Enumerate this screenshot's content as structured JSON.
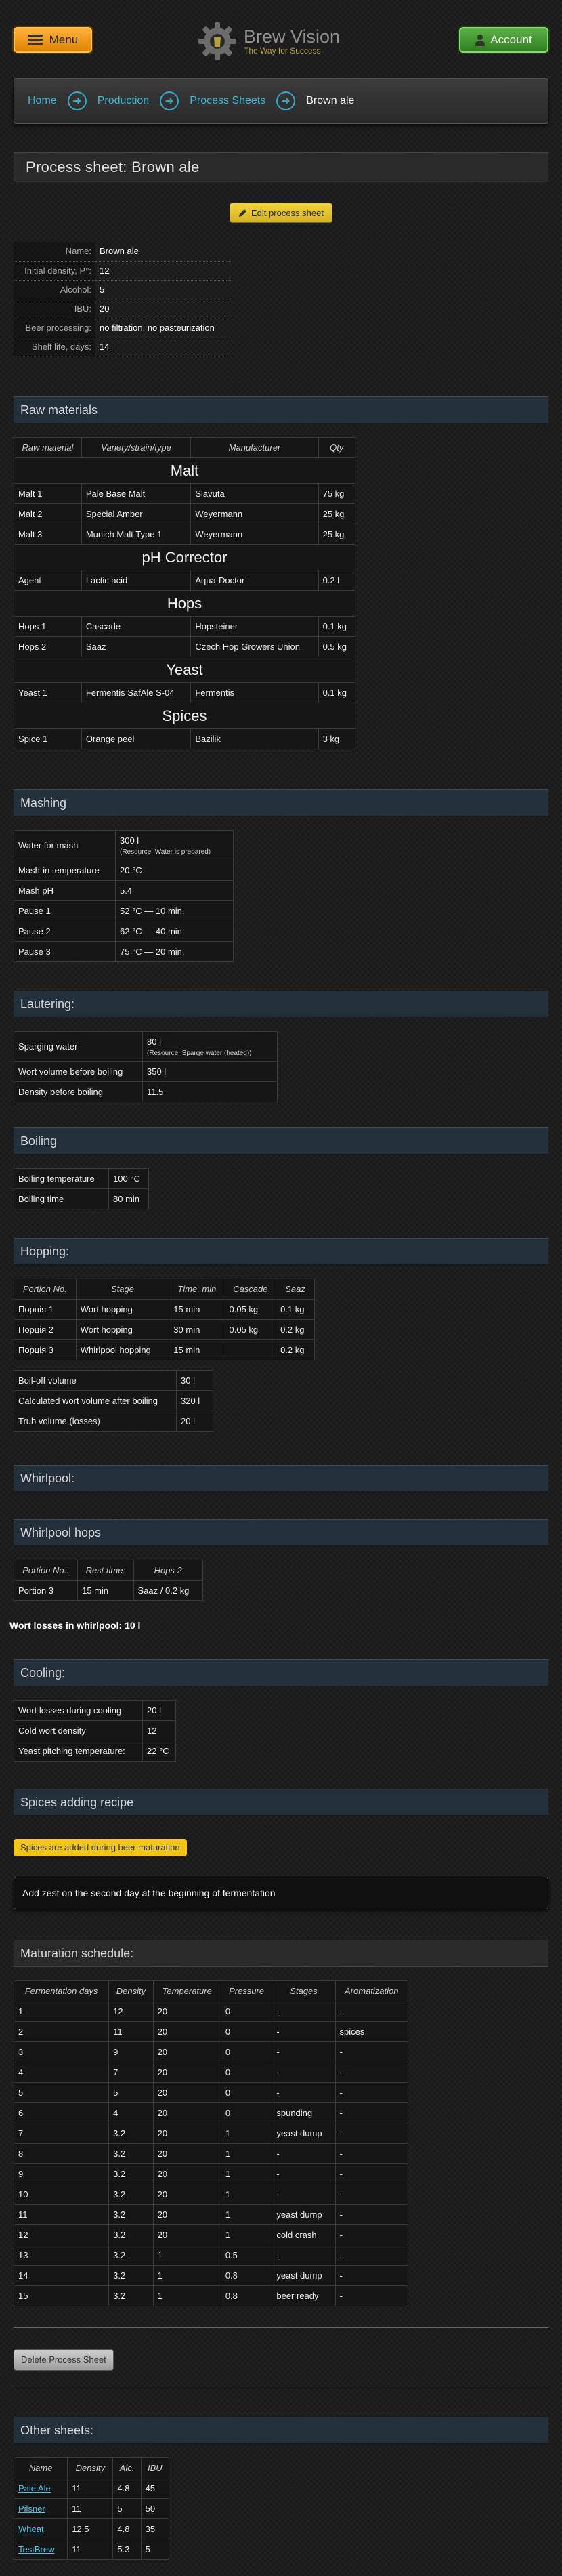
{
  "header": {
    "menu_label": "Menu",
    "logo_title": "Brew Vision",
    "logo_subtitle": "The Way for Success",
    "account_label": "Account",
    "accent_orange": "#f39c12",
    "accent_green": "#3c9a2c",
    "link_color": "#38b8d8"
  },
  "breadcrumb": {
    "items": [
      "Home",
      "Production",
      "Process Sheets"
    ],
    "current": "Brown ale"
  },
  "page_title": "Process sheet: Brown ale",
  "edit_button": "Edit process sheet",
  "info": [
    {
      "key": "Name:",
      "value": "Brown ale"
    },
    {
      "key": "Initial density, P°:",
      "value": "12"
    },
    {
      "key": "Alcohol:",
      "value": "5"
    },
    {
      "key": "IBU:",
      "value": "20"
    },
    {
      "key": "Beer processing:",
      "value": "no filtration, no pasteurization"
    },
    {
      "key": "Shelf life, days:",
      "value": "14"
    }
  ],
  "raw_materials": {
    "title": "Raw materials",
    "headers": [
      "Raw material",
      "Variety/strain/type",
      "Manufacturer",
      "Qty"
    ],
    "groups": [
      {
        "name": "Malt",
        "rows": [
          [
            "Malt 1",
            "Pale Base Malt",
            "Slavuta",
            "75 kg"
          ],
          [
            "Malt 2",
            "Special Amber",
            "Weyermann",
            "25 kg"
          ],
          [
            "Malt 3",
            "Munich Malt Type 1",
            "Weyermann",
            "25 kg"
          ]
        ]
      },
      {
        "name": "pH Corrector",
        "rows": [
          [
            "Agent",
            "Lactic acid",
            "Aqua-Doctor",
            "0.2 l"
          ]
        ]
      },
      {
        "name": "Hops",
        "rows": [
          [
            "Hops 1",
            "Cascade",
            "Hopsteiner",
            "0.1 kg"
          ],
          [
            "Hops 2",
            "Saaz",
            "Czech Hop Growers Union",
            "0.5 kg"
          ]
        ]
      },
      {
        "name": "Yeast",
        "rows": [
          [
            "Yeast 1",
            "Fermentis SafAle S-04",
            "Fermentis",
            "0.1 kg"
          ]
        ]
      },
      {
        "name": "Spices",
        "rows": [
          [
            "Spice 1",
            "Orange peel",
            "Bazilik",
            "3 kg"
          ]
        ]
      }
    ]
  },
  "mashing": {
    "title": "Mashing",
    "rows": [
      {
        "k": "Water for mash",
        "v": "300 l",
        "note": "(Resource: Water is prepared)"
      },
      {
        "k": "Mash-in temperature",
        "v": "20 °C"
      },
      {
        "k": "Mash pH",
        "v": "5.4"
      },
      {
        "k": "Pause 1",
        "v": "52 °C — 10 min."
      },
      {
        "k": "Pause 2",
        "v": "62 °C — 40 min."
      },
      {
        "k": "Pause 3",
        "v": "75 °C — 20 min."
      }
    ]
  },
  "lautering": {
    "title": "Lautering:",
    "rows": [
      {
        "k": "Sparging water",
        "v": "80 l",
        "note": "(Resource: Sparge water (heated))"
      },
      {
        "k": "Wort volume before boiling",
        "v": "350 l"
      },
      {
        "k": "Density before boiling",
        "v": "11.5"
      }
    ]
  },
  "boiling": {
    "title": "Boiling",
    "rows": [
      {
        "k": "Boiling temperature",
        "v": "100 °C"
      },
      {
        "k": "Boiling time",
        "v": "80 min"
      }
    ]
  },
  "hopping": {
    "title": "Hopping:",
    "headers": [
      "Portion No.",
      "Stage",
      "Time, min",
      "Cascade",
      "Saaz"
    ],
    "rows": [
      [
        "Порція 1",
        "Wort hopping",
        "15 min",
        "0.05 kg",
        "0.1 kg"
      ],
      [
        "Порція 2",
        "Wort hopping",
        "30 min",
        "0.05 kg",
        "0.2 kg"
      ],
      [
        "Порція 3",
        "Whirlpool hopping",
        "15 min",
        "",
        "0.2 kg"
      ]
    ],
    "summary": [
      {
        "k": "Boil-off volume",
        "v": "30 l"
      },
      {
        "k": "Calculated wort volume after boiling",
        "v": "320 l"
      },
      {
        "k": "Trub volume (losses)",
        "v": "20 l"
      }
    ]
  },
  "whirlpool": {
    "title": "Whirlpool:",
    "hops_title": "Whirlpool hops",
    "headers": [
      "Portion No.:",
      "Rest time:",
      "Hops 2"
    ],
    "rows": [
      [
        "Portion 3",
        "15 min",
        "Saaz / 0.2 kg"
      ]
    ],
    "losses": "Wort losses in whirlpool: 10 l"
  },
  "cooling": {
    "title": "Cooling:",
    "rows": [
      {
        "k": "Wort losses during cooling",
        "v": "20 l"
      },
      {
        "k": "Cold wort density",
        "v": "12"
      },
      {
        "k": "Yeast pitching temperature:",
        "v": "22 °C"
      }
    ]
  },
  "spices": {
    "title": "Spices adding recipe",
    "badge": "Spices are added during beer maturation",
    "note": "Add zest on the second day at the beginning of fermentation"
  },
  "maturation": {
    "title": "Maturation schedule:",
    "headers": [
      "Fermentation days",
      "Density",
      "Temperature",
      "Pressure",
      "Stages",
      "Aromatization"
    ],
    "rows": [
      [
        "1",
        "12",
        "20",
        "0",
        "-",
        "-"
      ],
      [
        "2",
        "11",
        "20",
        "0",
        "-",
        "spices"
      ],
      [
        "3",
        "9",
        "20",
        "0",
        "-",
        "-"
      ],
      [
        "4",
        "7",
        "20",
        "0",
        "-",
        "-"
      ],
      [
        "5",
        "5",
        "20",
        "0",
        "-",
        "-"
      ],
      [
        "6",
        "4",
        "20",
        "0",
        "spunding",
        "-"
      ],
      [
        "7",
        "3.2",
        "20",
        "1",
        "yeast dump",
        "-"
      ],
      [
        "8",
        "3.2",
        "20",
        "1",
        "-",
        "-"
      ],
      [
        "9",
        "3.2",
        "20",
        "1",
        "-",
        "-"
      ],
      [
        "10",
        "3.2",
        "20",
        "1",
        "-",
        "-"
      ],
      [
        "11",
        "3.2",
        "20",
        "1",
        "yeast dump",
        "-"
      ],
      [
        "12",
        "3.2",
        "20",
        "1",
        "cold crash",
        "-"
      ],
      [
        "13",
        "3.2",
        "1",
        "0.5",
        "-",
        "-"
      ],
      [
        "14",
        "3.2",
        "1",
        "0.8",
        "yeast dump",
        "-"
      ],
      [
        "15",
        "3.2",
        "1",
        "0.8",
        "beer ready",
        "-"
      ]
    ]
  },
  "delete_button": "Delete Process Sheet",
  "other_sheets": {
    "title": "Other sheets:",
    "headers": [
      "Name",
      "Density",
      "Alc.",
      "IBU"
    ],
    "rows": [
      [
        "Pale Ale",
        "11",
        "4.8",
        "45"
      ],
      [
        "Pilsner",
        "11",
        "5",
        "50"
      ],
      [
        "Wheat",
        "12.5",
        "4.8",
        "35"
      ],
      [
        "TestBrew",
        "11",
        "5.3",
        "5"
      ]
    ]
  }
}
